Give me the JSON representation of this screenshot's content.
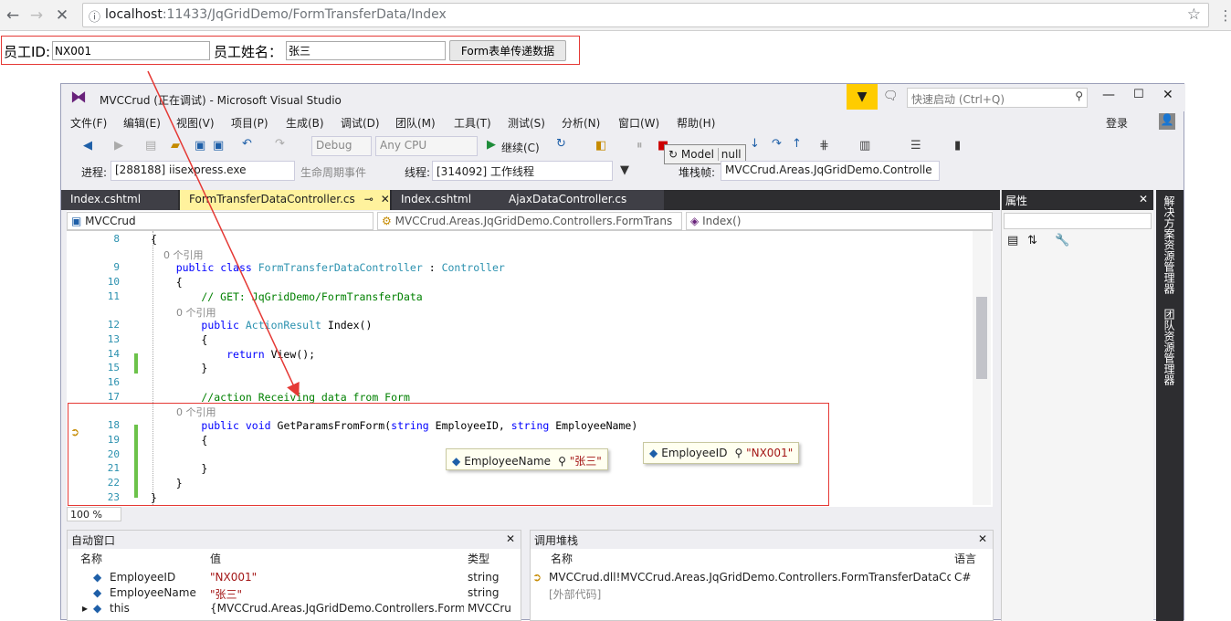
{
  "browser": {
    "url_host": "localhost",
    "url_path": ":11433/JqGridDemo/FormTransferData/Index",
    "back_icon": "back-arrow-icon",
    "forward_icon": "forward-arrow-icon",
    "reload_icon": "close-x-icon",
    "star_icon": "bookmark-star-icon",
    "menu_icon": "kebab-menu-icon"
  },
  "form": {
    "id_label": "员工ID:",
    "id_value": "NX001",
    "name_label": "员工姓名：",
    "name_value": "张三",
    "submit_label": "Form表单传递数据"
  },
  "vs": {
    "title": "MVCCrud (正在调试) - Microsoft Visual Studio",
    "quick_launch": "快速启动 (Ctrl+Q)",
    "login": "登录",
    "menu": [
      "文件(F)",
      "编辑(E)",
      "视图(V)",
      "项目(P)",
      "生成(B)",
      "调试(D)",
      "团队(M)",
      "工具(T)",
      "测试(S)",
      "分析(N)",
      "窗口(W)",
      "帮助(H)"
    ],
    "toolbar": {
      "config": "Debug",
      "platform": "Any CPU",
      "continue": "继续(C)",
      "model_label": "Model",
      "model_value": "null"
    },
    "debugbar": {
      "process_label": "进程:",
      "process_value": "[288188] iisexpress.exe",
      "lifecycle": "生命周期事件",
      "thread_label": "线程:",
      "thread_value": "[314092] 工作线程",
      "stack_label": "堆栈帧:",
      "stack_value": "MVCCrud.Areas.JqGridDemo.Controlle"
    },
    "tabs": [
      "Index.cshtml",
      "FormTransferDataController.cs",
      "Index.cshtml",
      "AjaxDataController.cs"
    ],
    "navbar": {
      "project": "MVCCrud",
      "class": "MVCCrud.Areas.JqGridDemo.Controllers.FormTrans",
      "member": "Index()"
    },
    "code_lines": [
      {
        "n": "8",
        "t": "{"
      },
      {
        "n": "",
        "t": "    0 个引用"
      },
      {
        "n": "9",
        "t": "    public class FormTransferDataController : Controller"
      },
      {
        "n": "10",
        "t": "    {"
      },
      {
        "n": "11",
        "t": "        // GET: JqGridDemo/FormTransferData"
      },
      {
        "n": "",
        "t": "        0 个引用"
      },
      {
        "n": "12",
        "t": "        public ActionResult Index()"
      },
      {
        "n": "13",
        "t": "        {"
      },
      {
        "n": "14",
        "t": "            return View();"
      },
      {
        "n": "15",
        "t": "        }"
      },
      {
        "n": "16",
        "t": ""
      },
      {
        "n": "17",
        "t": "        //action Receiving data from Form"
      },
      {
        "n": "",
        "t": "        0 个引用"
      },
      {
        "n": "18",
        "t": "        public void GetParamsFromForm(string EmployeeID, string EmployeeName)"
      },
      {
        "n": "19",
        "t": "        {"
      },
      {
        "n": "20",
        "t": ""
      },
      {
        "n": "21",
        "t": "        }"
      },
      {
        "n": "22",
        "t": "    }"
      },
      {
        "n": "23",
        "t": "}"
      }
    ],
    "tips": [
      {
        "name": "EmployeeName",
        "value": "\"张三\""
      },
      {
        "name": "EmployeeID",
        "value": "\"NX001\""
      }
    ],
    "zoom": "100 %",
    "properties_title": "属性",
    "side_tabs": [
      "解决方案资源管理器",
      "团队资源管理器"
    ],
    "autos": {
      "title": "自动窗口",
      "cols": [
        "名称",
        "值",
        "类型"
      ],
      "rows": [
        {
          "name": "EmployeeID",
          "value": "\"NX001\"",
          "type": "string"
        },
        {
          "name": "EmployeeName",
          "value": "\"张三\"",
          "type": "string"
        },
        {
          "name": "this",
          "value": "{MVCCrud.Areas.JqGridDemo.Controllers.FormTransf",
          "type": "MVCCru"
        }
      ]
    },
    "callstack": {
      "title": "调用堆栈",
      "cols": [
        "名称",
        "语言"
      ],
      "rows": [
        {
          "name": "MVCCrud.dll!MVCCrud.Areas.JqGridDemo.Controllers.FormTransferDataController.",
          "lang": "C#"
        },
        {
          "name": "[外部代码]",
          "lang": ""
        }
      ]
    }
  }
}
